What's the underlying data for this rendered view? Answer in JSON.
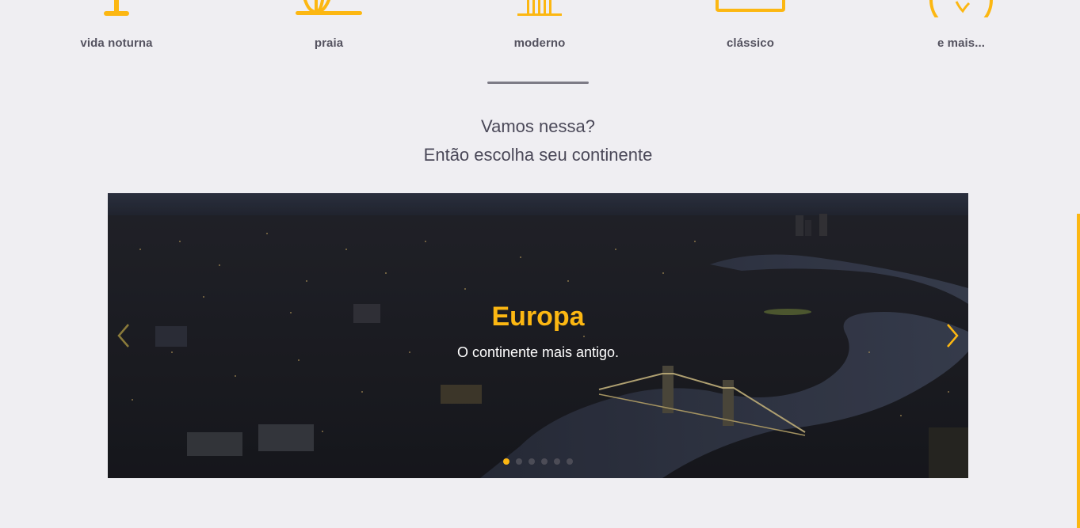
{
  "categories": [
    {
      "label": "vida noturna",
      "icon": "nightlife-icon"
    },
    {
      "label": "praia",
      "icon": "beach-icon"
    },
    {
      "label": "moderno",
      "icon": "modern-building-icon"
    },
    {
      "label": "clássico",
      "icon": "classic-icon"
    },
    {
      "label": "e mais...",
      "icon": "globe-icon"
    }
  ],
  "heading": {
    "line1": "Vamos nessa?",
    "line2": "Então escolha seu continente"
  },
  "carousel": {
    "slide_title": "Europa",
    "slide_text": "O continente mais antigo.",
    "slide_count": 6,
    "active_index": 0,
    "prev_icon": "chevron-left-icon",
    "next_icon": "chevron-right-icon"
  },
  "colors": {
    "accent": "#fcb712",
    "background": "#efeef2",
    "text": "#4a4858"
  }
}
